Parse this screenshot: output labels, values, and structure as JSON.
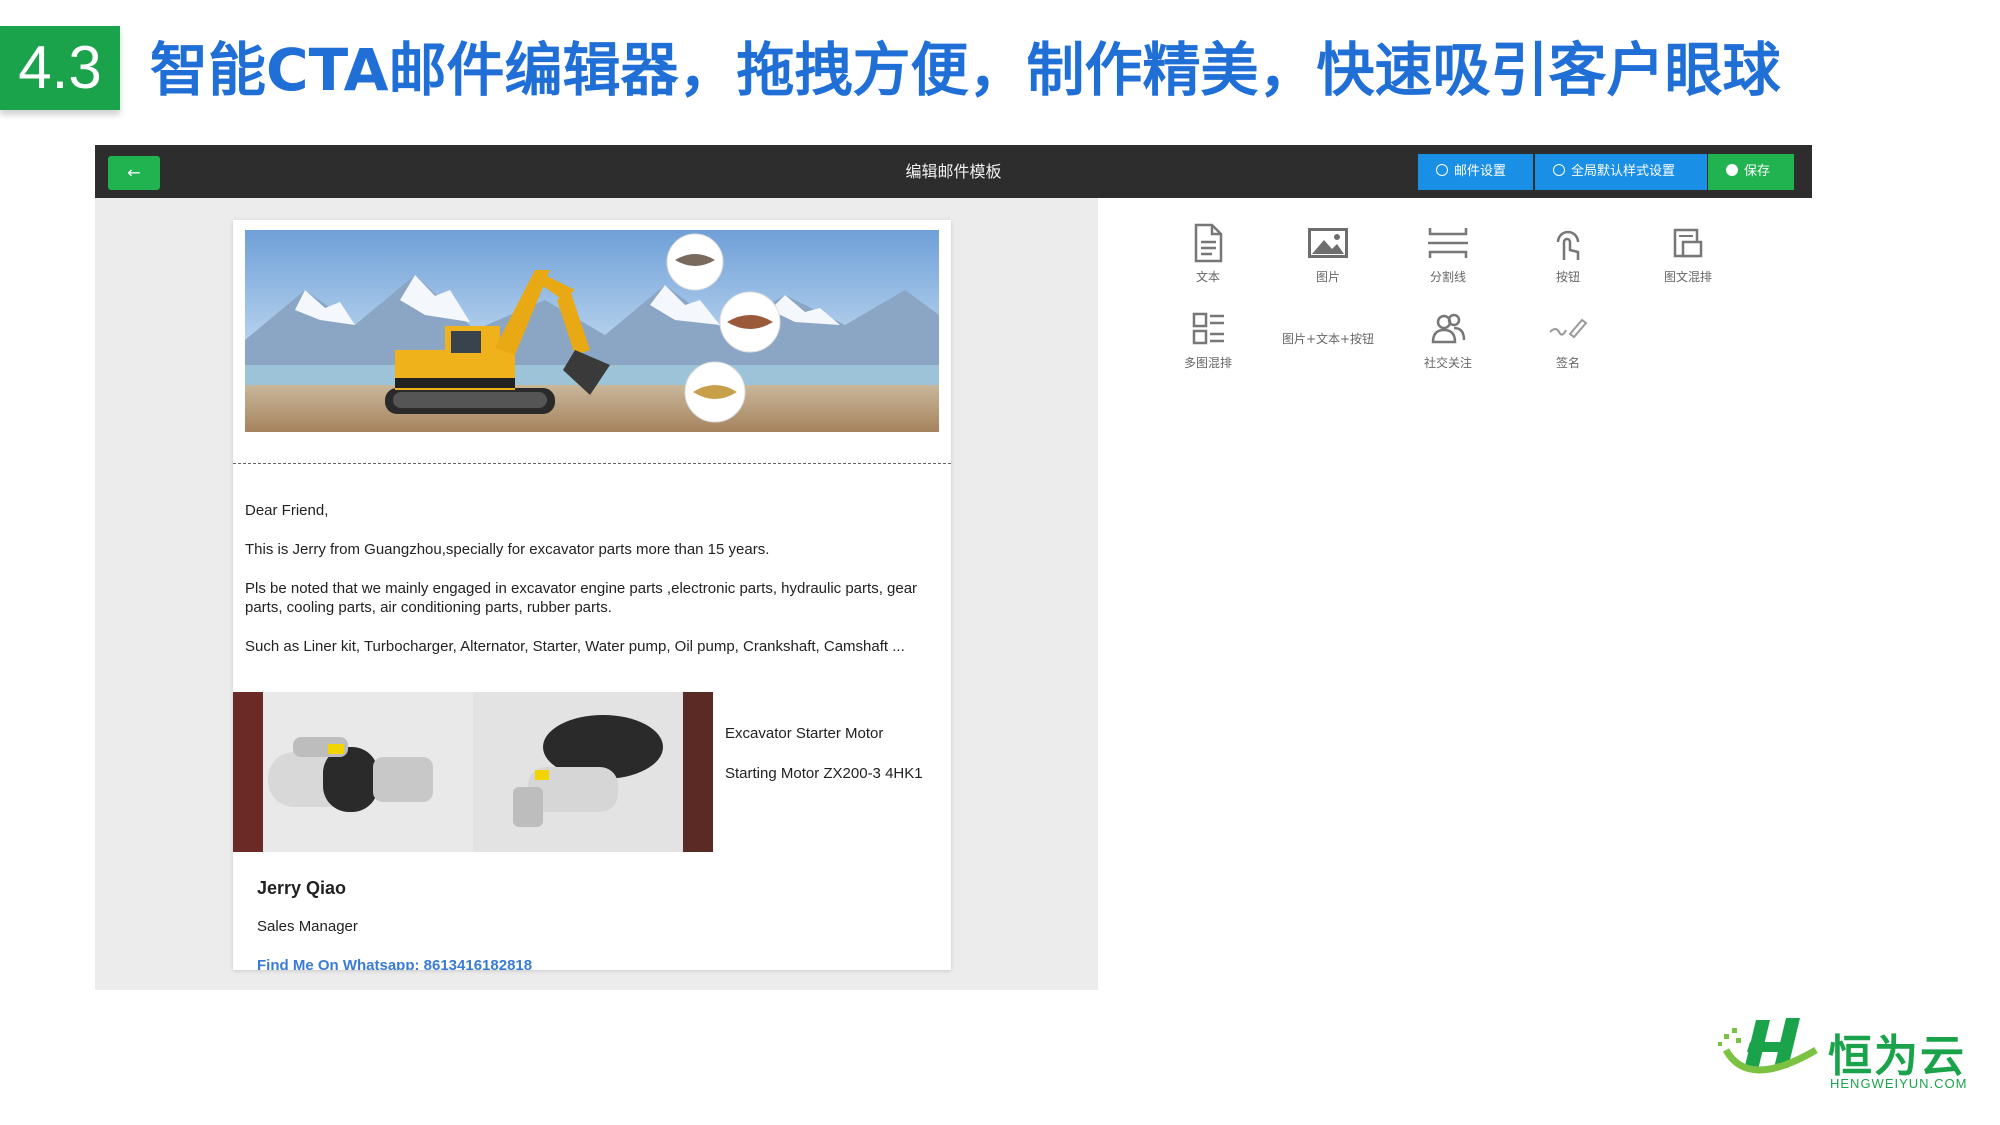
{
  "slide": {
    "section": "4.3",
    "title": "智能CTA邮件编辑器，拖拽方便，制作精美，快速吸引客户眼球"
  },
  "topbar": {
    "back_label": "←",
    "title": "编辑邮件模板",
    "mail_settings": "邮件设置",
    "global_style": "全局默认样式设置",
    "save": "保存"
  },
  "email": {
    "greeting": "Dear Friend,",
    "intro": "This is Jerry from Guangzhou,specially for excavator parts more than 15 years.",
    "parts": "Pls be noted that we mainly engaged in excavator engine parts ,electronic parts, hydraulic parts, gear parts, cooling parts, air conditioning parts, rubber parts.",
    "examples": "Such as Liner kit, Turbocharger, Alternator, Starter, Water pump, Oil pump, Crankshaft, Camshaft ...",
    "product_name": "Excavator Starter Motor",
    "product_model": "Starting Motor ZX200-3 4HK1",
    "sig_name": "Jerry Qiao",
    "sig_title": "Sales Manager",
    "sig_link": "Find Me On Whatsapp: 8613416182818"
  },
  "palette": {
    "items": [
      {
        "label": "文本",
        "icon": "document-icon"
      },
      {
        "label": "图片",
        "icon": "image-icon"
      },
      {
        "label": "分割线",
        "icon": "divider-icon"
      },
      {
        "label": "按钮",
        "icon": "tap-icon"
      },
      {
        "label": "图文混排",
        "icon": "image-text-icon"
      },
      {
        "label": "多图混排",
        "icon": "grid-list-icon"
      },
      {
        "label": "图片+文本+按钮",
        "icon": "image-text-button-icon"
      },
      {
        "label": "社交关注",
        "icon": "people-icon"
      },
      {
        "label": "签名",
        "icon": "signature-icon"
      }
    ]
  },
  "logo": {
    "name": "恒为云",
    "domain": "HENGWEIYUN.COM"
  },
  "colors": {
    "green": "#1aa34a",
    "blue": "#1a8fe6",
    "title_blue": "#1f6fd6",
    "topbar": "#2d2d2d"
  }
}
